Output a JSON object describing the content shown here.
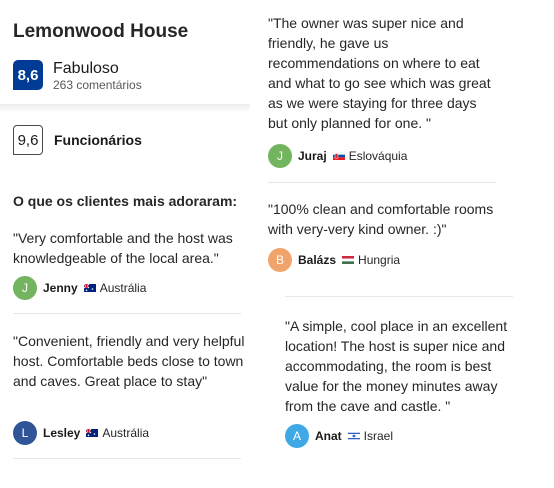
{
  "property": {
    "name": "Lemonwood House",
    "score": "8,6",
    "score_label": "Fabuloso",
    "review_count": "263 comentários"
  },
  "category": {
    "score": "9,6",
    "label": "Funcionários"
  },
  "loved_heading": "O que os clientes mais adoraram:",
  "reviews": [
    {
      "text": "\"Very comfortable and the host was knowledgeable of the local area.\"",
      "initial": "J",
      "name": "Jenny",
      "country": "Austrália",
      "avatar_color": "#73b55f",
      "flag": "flag-australia-icon"
    },
    {
      "text": "\"Convenient, friendly and very helpful host. Comfortable beds close to town and caves. Great place to stay\"",
      "initial": "L",
      "name": "Lesley",
      "country": "Austrália",
      "avatar_color": "#2f5597",
      "flag": "flag-australia-icon"
    },
    {
      "text": "\"The owner was super nice and friendly, he gave us recommendations on where to eat and what to go see which was great as we were staying for three days but only planned for one. \"",
      "initial": "J",
      "name": "Juraj",
      "country": "Eslováquia",
      "avatar_color": "#73b55f",
      "flag": "flag-slovakia-icon"
    },
    {
      "text": "\"100% clean and comfortable rooms with very-very kind owner. :)\"",
      "initial": "B",
      "name": "Balázs",
      "country": "Hungria",
      "avatar_color": "#f0a46b",
      "flag": "flag-hungary-icon"
    },
    {
      "text": "\"A simple, cool place in an excellent location! The host is super nice and accommodating, the room is best value for the money minutes away from the cave and castle. \"",
      "initial": "A",
      "name": "Anat",
      "country": "Israel",
      "avatar_color": "#3fa9e6",
      "flag": "flag-israel-icon"
    }
  ]
}
